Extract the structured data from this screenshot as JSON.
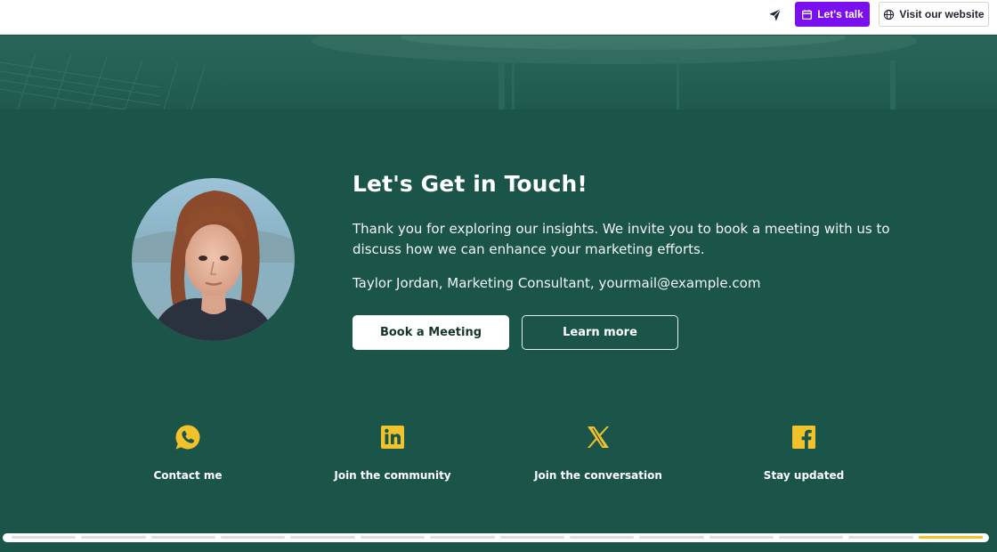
{
  "topbar": {
    "icons": {
      "send": "send-icon",
      "calendar": "calendar-icon",
      "globe": "globe-icon"
    },
    "talk_label": "Let's talk",
    "visit_label": "Visit our website"
  },
  "contact": {
    "title": "Let's Get in Touch!",
    "intro": "Thank you for exploring our insights. We invite you to book a meeting with us to discuss how we can enhance your marketing efforts.",
    "person_line": "Taylor Jordan, Marketing Consultant, yourmail@example.com",
    "book_label": "Book a Meeting",
    "learn_label": "Learn more"
  },
  "social": [
    {
      "icon": "whatsapp-icon",
      "label": "Contact me"
    },
    {
      "icon": "linkedin-icon",
      "label": "Join the community"
    },
    {
      "icon": "x-icon",
      "label": "Join the conversation"
    },
    {
      "icon": "facebook-icon",
      "label": "Stay updated"
    }
  ],
  "progress": {
    "segments": 14,
    "active_index": 13
  },
  "colors": {
    "background": "#1b5449",
    "accent_purple": "#7a0ff0",
    "icon_yellow": "#f1c22b",
    "text_white": "#ffffff"
  }
}
